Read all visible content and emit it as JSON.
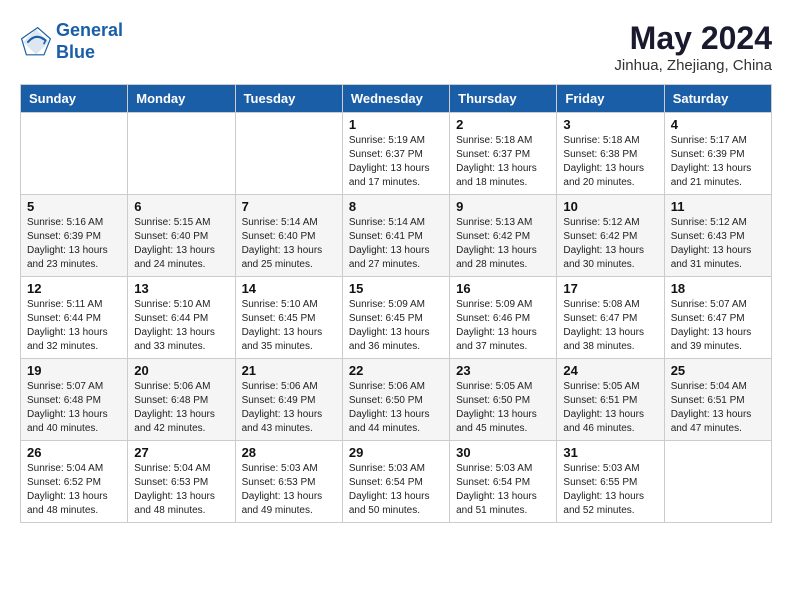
{
  "header": {
    "logo_line1": "General",
    "logo_line2": "Blue",
    "month_year": "May 2024",
    "location": "Jinhua, Zhejiang, China"
  },
  "days_of_week": [
    "Sunday",
    "Monday",
    "Tuesday",
    "Wednesday",
    "Thursday",
    "Friday",
    "Saturday"
  ],
  "weeks": [
    {
      "alt": false,
      "days": [
        {
          "date": "",
          "info": ""
        },
        {
          "date": "",
          "info": ""
        },
        {
          "date": "",
          "info": ""
        },
        {
          "date": "1",
          "info": "Sunrise: 5:19 AM\nSunset: 6:37 PM\nDaylight: 13 hours\nand 17 minutes."
        },
        {
          "date": "2",
          "info": "Sunrise: 5:18 AM\nSunset: 6:37 PM\nDaylight: 13 hours\nand 18 minutes."
        },
        {
          "date": "3",
          "info": "Sunrise: 5:18 AM\nSunset: 6:38 PM\nDaylight: 13 hours\nand 20 minutes."
        },
        {
          "date": "4",
          "info": "Sunrise: 5:17 AM\nSunset: 6:39 PM\nDaylight: 13 hours\nand 21 minutes."
        }
      ]
    },
    {
      "alt": true,
      "days": [
        {
          "date": "5",
          "info": "Sunrise: 5:16 AM\nSunset: 6:39 PM\nDaylight: 13 hours\nand 23 minutes."
        },
        {
          "date": "6",
          "info": "Sunrise: 5:15 AM\nSunset: 6:40 PM\nDaylight: 13 hours\nand 24 minutes."
        },
        {
          "date": "7",
          "info": "Sunrise: 5:14 AM\nSunset: 6:40 PM\nDaylight: 13 hours\nand 25 minutes."
        },
        {
          "date": "8",
          "info": "Sunrise: 5:14 AM\nSunset: 6:41 PM\nDaylight: 13 hours\nand 27 minutes."
        },
        {
          "date": "9",
          "info": "Sunrise: 5:13 AM\nSunset: 6:42 PM\nDaylight: 13 hours\nand 28 minutes."
        },
        {
          "date": "10",
          "info": "Sunrise: 5:12 AM\nSunset: 6:42 PM\nDaylight: 13 hours\nand 30 minutes."
        },
        {
          "date": "11",
          "info": "Sunrise: 5:12 AM\nSunset: 6:43 PM\nDaylight: 13 hours\nand 31 minutes."
        }
      ]
    },
    {
      "alt": false,
      "days": [
        {
          "date": "12",
          "info": "Sunrise: 5:11 AM\nSunset: 6:44 PM\nDaylight: 13 hours\nand 32 minutes."
        },
        {
          "date": "13",
          "info": "Sunrise: 5:10 AM\nSunset: 6:44 PM\nDaylight: 13 hours\nand 33 minutes."
        },
        {
          "date": "14",
          "info": "Sunrise: 5:10 AM\nSunset: 6:45 PM\nDaylight: 13 hours\nand 35 minutes."
        },
        {
          "date": "15",
          "info": "Sunrise: 5:09 AM\nSunset: 6:45 PM\nDaylight: 13 hours\nand 36 minutes."
        },
        {
          "date": "16",
          "info": "Sunrise: 5:09 AM\nSunset: 6:46 PM\nDaylight: 13 hours\nand 37 minutes."
        },
        {
          "date": "17",
          "info": "Sunrise: 5:08 AM\nSunset: 6:47 PM\nDaylight: 13 hours\nand 38 minutes."
        },
        {
          "date": "18",
          "info": "Sunrise: 5:07 AM\nSunset: 6:47 PM\nDaylight: 13 hours\nand 39 minutes."
        }
      ]
    },
    {
      "alt": true,
      "days": [
        {
          "date": "19",
          "info": "Sunrise: 5:07 AM\nSunset: 6:48 PM\nDaylight: 13 hours\nand 40 minutes."
        },
        {
          "date": "20",
          "info": "Sunrise: 5:06 AM\nSunset: 6:48 PM\nDaylight: 13 hours\nand 42 minutes."
        },
        {
          "date": "21",
          "info": "Sunrise: 5:06 AM\nSunset: 6:49 PM\nDaylight: 13 hours\nand 43 minutes."
        },
        {
          "date": "22",
          "info": "Sunrise: 5:06 AM\nSunset: 6:50 PM\nDaylight: 13 hours\nand 44 minutes."
        },
        {
          "date": "23",
          "info": "Sunrise: 5:05 AM\nSunset: 6:50 PM\nDaylight: 13 hours\nand 45 minutes."
        },
        {
          "date": "24",
          "info": "Sunrise: 5:05 AM\nSunset: 6:51 PM\nDaylight: 13 hours\nand 46 minutes."
        },
        {
          "date": "25",
          "info": "Sunrise: 5:04 AM\nSunset: 6:51 PM\nDaylight: 13 hours\nand 47 minutes."
        }
      ]
    },
    {
      "alt": false,
      "days": [
        {
          "date": "26",
          "info": "Sunrise: 5:04 AM\nSunset: 6:52 PM\nDaylight: 13 hours\nand 48 minutes."
        },
        {
          "date": "27",
          "info": "Sunrise: 5:04 AM\nSunset: 6:53 PM\nDaylight: 13 hours\nand 48 minutes."
        },
        {
          "date": "28",
          "info": "Sunrise: 5:03 AM\nSunset: 6:53 PM\nDaylight: 13 hours\nand 49 minutes."
        },
        {
          "date": "29",
          "info": "Sunrise: 5:03 AM\nSunset: 6:54 PM\nDaylight: 13 hours\nand 50 minutes."
        },
        {
          "date": "30",
          "info": "Sunrise: 5:03 AM\nSunset: 6:54 PM\nDaylight: 13 hours\nand 51 minutes."
        },
        {
          "date": "31",
          "info": "Sunrise: 5:03 AM\nSunset: 6:55 PM\nDaylight: 13 hours\nand 52 minutes."
        },
        {
          "date": "",
          "info": ""
        }
      ]
    }
  ]
}
